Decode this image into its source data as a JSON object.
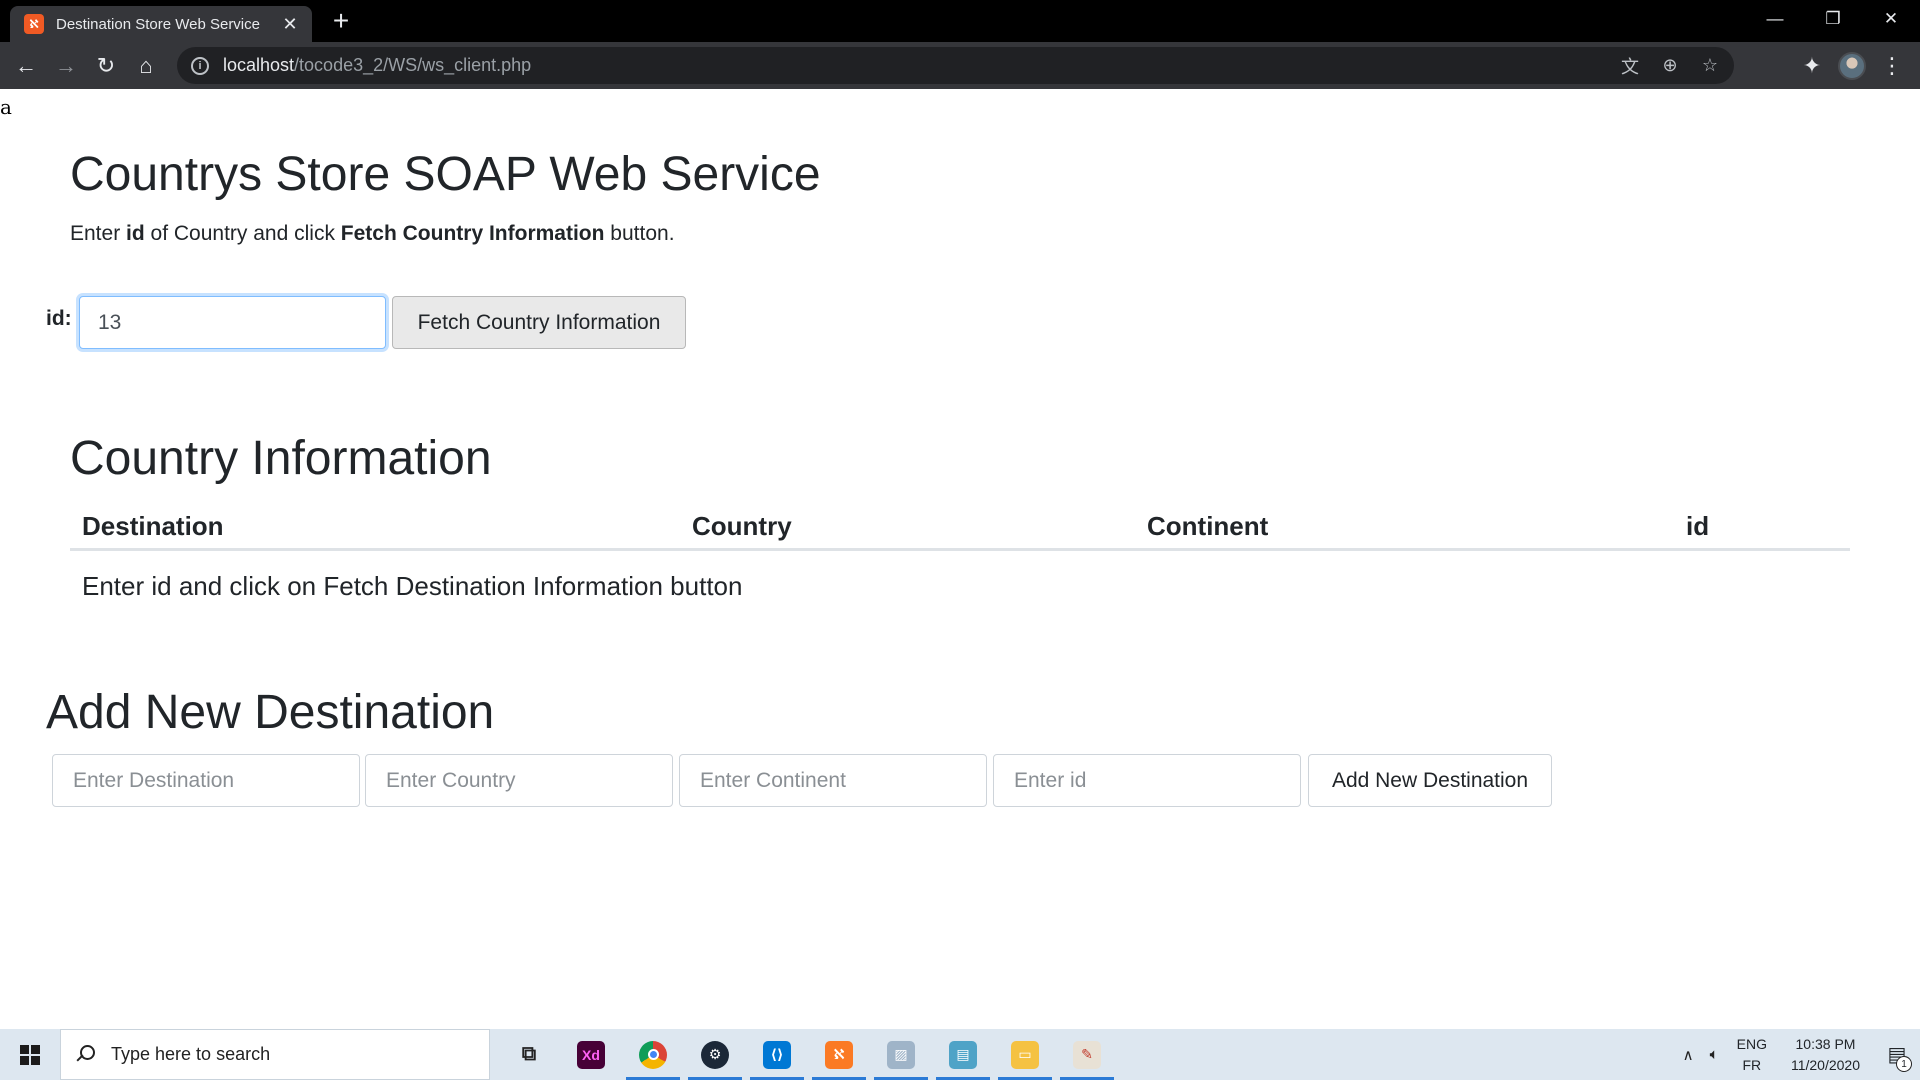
{
  "browser": {
    "tab_title": "Destination Store Web Service",
    "tab_favicon": "xampp-icon",
    "url_host": "localhost",
    "url_path": "/tocode3_2/WS/ws_client.php"
  },
  "page": {
    "stray_text": "a",
    "title": "Countrys Store SOAP Web Service",
    "lead": {
      "p1": "Enter ",
      "b1": "id",
      "p2": " of Country and click ",
      "b2": "Fetch Country Information",
      "p3": " button."
    },
    "id_label": "id:",
    "id_value": "13",
    "fetch_button": "Fetch Country Information",
    "info_title": "Country Information",
    "table_headers": [
      "Destination",
      "Country",
      "Continent",
      "id"
    ],
    "table_message": "Enter id and click on Fetch Destination Information button",
    "add_title": "Add New Destination",
    "add_placeholders": [
      "Enter Destination",
      "Enter Country",
      "Enter Continent",
      "Enter id"
    ],
    "add_button": "Add New Destination"
  },
  "taskbar": {
    "search_placeholder": "Type here to search",
    "apps": [
      "task-view-icon",
      "adobe-xd-icon",
      "chrome-icon",
      "steam-icon",
      "vscode-icon",
      "xampp-icon",
      "photos-icon",
      "notepad-icon",
      "file-explorer-icon",
      "paint-icon"
    ],
    "lang_top": "ENG",
    "lang_bottom": "FR",
    "time": "10:38 PM",
    "date": "11/20/2020",
    "notification_count": "1"
  }
}
